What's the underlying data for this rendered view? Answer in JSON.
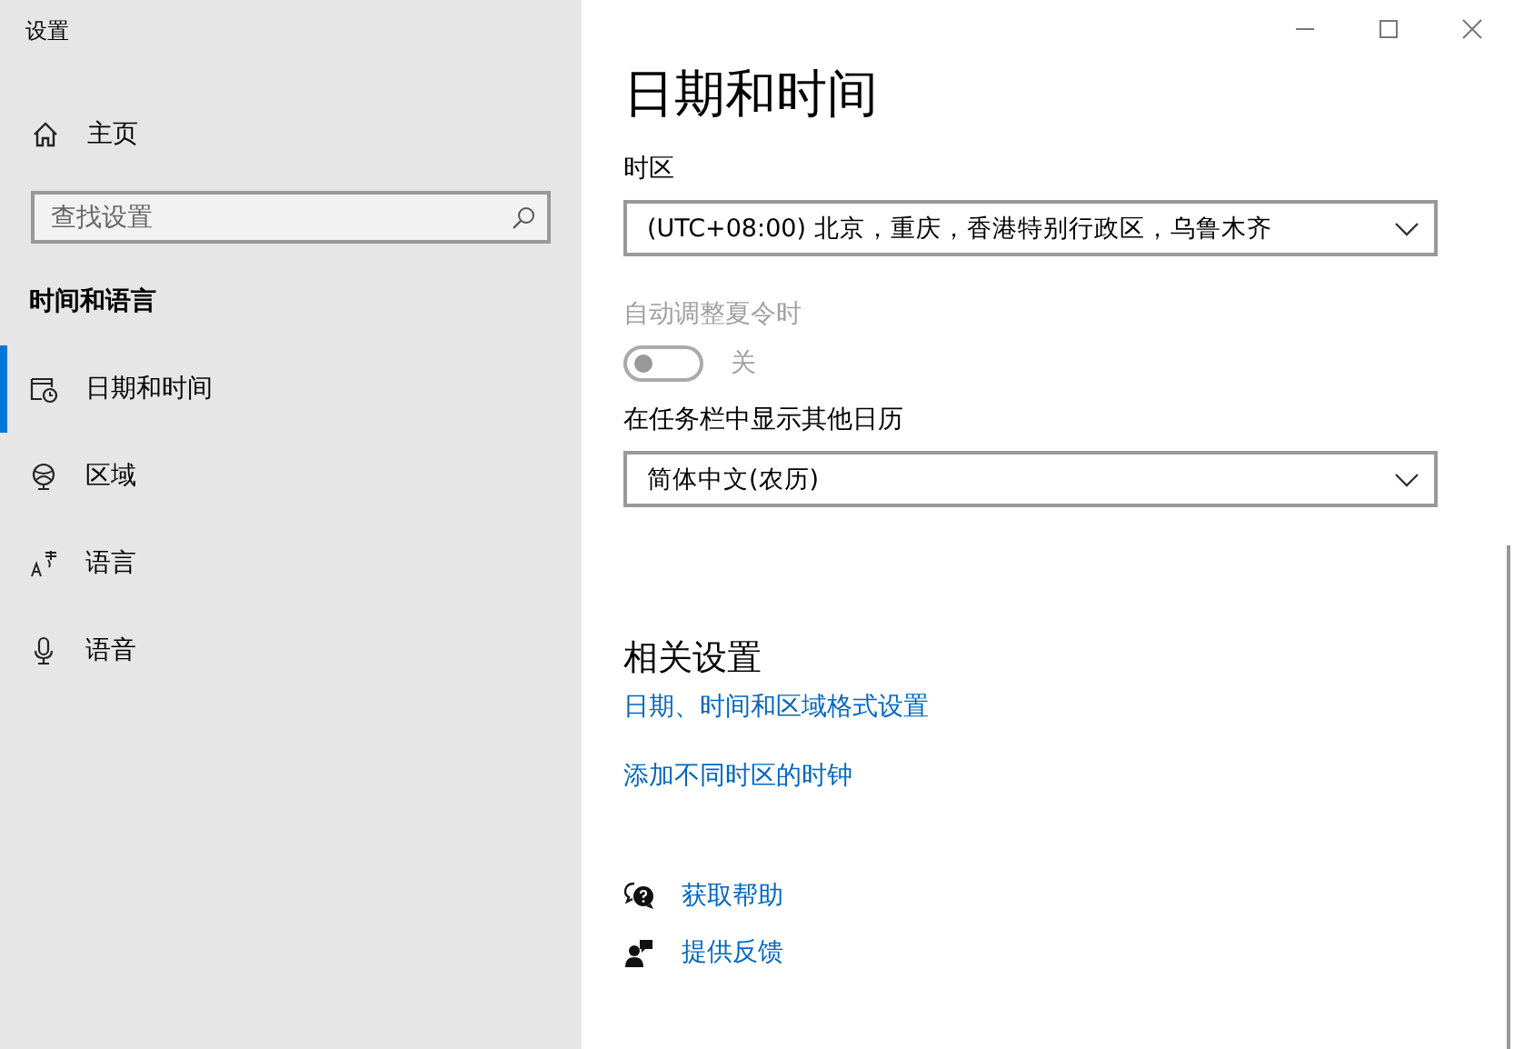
{
  "window": {
    "title": "设置"
  },
  "sidebar": {
    "home": "主页",
    "search": {
      "placeholder": "查找设置"
    },
    "section": "时间和语言",
    "items": [
      {
        "label": "日期和时间",
        "kind": "calendar",
        "selected": true
      },
      {
        "label": "区域",
        "kind": "globe",
        "selected": false
      },
      {
        "label": "语言",
        "kind": "language",
        "selected": false
      },
      {
        "label": "语音",
        "kind": "mic",
        "selected": false
      }
    ]
  },
  "page": {
    "title": "日期和时间",
    "timezone": {
      "label": "时区",
      "value": "(UTC+08:00) 北京，重庆，香港特别行政区，乌鲁木齐"
    },
    "dst": {
      "label": "自动调整夏令时",
      "on": false,
      "disabled": true,
      "state_label": "关"
    },
    "calendar": {
      "label": "在任务栏中显示其他日历",
      "value": "简体中文(农历)"
    },
    "related": {
      "title": "相关设置",
      "links": [
        "日期、时间和区域格式设置",
        "添加不同时区的时钟"
      ]
    },
    "help": [
      {
        "kind": "help",
        "label": "获取帮助"
      },
      {
        "kind": "feedback",
        "label": "提供反馈"
      }
    ]
  }
}
